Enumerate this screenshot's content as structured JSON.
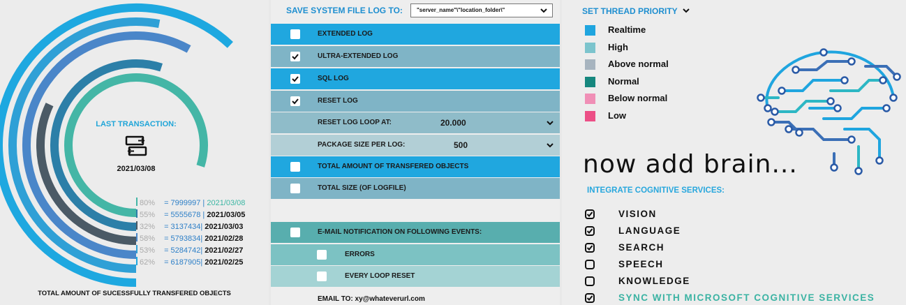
{
  "left": {
    "last_transaction_label": "LAST TRANSACTION:",
    "last_transaction_date": "2021/03/08",
    "transfer_icon": "transfer-arrows-icon",
    "rows": [
      {
        "pct": "80%",
        "value": "= 7999997 |",
        "date": "2021/03/08",
        "percent": 80
      },
      {
        "pct": "55%",
        "value": "= 5555678 |",
        "date": "2021/03/05",
        "percent": 55
      },
      {
        "pct": "32%",
        "value": "= 3137434|",
        "date": "2021/03/03",
        "percent": 32
      },
      {
        "pct": "58%",
        "value": "= 5793834|",
        "date": "2021/02/28",
        "percent": 58
      },
      {
        "pct": "53%",
        "value": "= 5284742|",
        "date": "2021/02/27",
        "percent": 53
      },
      {
        "pct": "62%",
        "value": "= 6187905|",
        "date": "2021/02/25",
        "percent": 62
      }
    ],
    "row_colors": [
      "#44b6a6",
      "#2c7fa8",
      "#4b5a66",
      "#4a86c9",
      "#2fa0d6",
      "#1ea8e0"
    ],
    "footer": "TOTAL AMOUNT OF SUCESSFULLY TRANSFERED OBJECTS"
  },
  "middle": {
    "save_label": "SAVE SYSTEM FILE LOG TO:",
    "save_select_value": "\"server_name\"\\\"location_folder\\\"",
    "options": [
      {
        "label": "EXTENDED LOG",
        "checked": false
      },
      {
        "label": "ULTRA-EXTENDED LOG",
        "checked": true
      },
      {
        "label": "SQL LOG",
        "checked": true
      },
      {
        "label": "RESET LOG",
        "checked": true
      }
    ],
    "reset_loop_label": "RESET LOG LOOP AT:",
    "reset_loop_value": "20.000",
    "package_size_label": "PACKAGE SIZE PER LOG:",
    "package_size_value": "500",
    "total_objects_label": "TOTAL AMOUNT OF TRANSFERED OBJECTS",
    "total_size_label": "TOTAL SIZE (OF LOGFILE)",
    "email_notify_label": "E-MAIL NOTIFICATION ON FOLLOWING EVENTS:",
    "errors_label": "ERRORS",
    "loop_reset_label": "EVERY LOOP RESET",
    "email_to": "EMAIL TO: xy@whateverurl.com"
  },
  "right": {
    "priority_title": "SET THREAD PRIORITY",
    "priorities": [
      {
        "label": "Realtime",
        "color": "#1fa5df"
      },
      {
        "label": "High",
        "color": "#7cc4cd"
      },
      {
        "label": "Above normal",
        "color": "#a7b4bf"
      },
      {
        "label": "Normal",
        "color": "#16877e"
      },
      {
        "label": "Below normal",
        "color": "#f08fb6"
      },
      {
        "label": "Low",
        "color": "#ec4f86"
      }
    ],
    "brain_title": "now add brain...",
    "integrate_label": "INTEGRATE COGNITIVE SERVICES:",
    "services": [
      {
        "label": "VISION",
        "checked": true
      },
      {
        "label": "LANGUAGE",
        "checked": true
      },
      {
        "label": "SEARCH",
        "checked": true
      },
      {
        "label": "SPEECH",
        "checked": false
      },
      {
        "label": "KNOWLEDGE",
        "checked": false
      },
      {
        "label": "SYNC WITH MICROSOFT COGNITIVE SERVICES",
        "checked": true
      }
    ],
    "brain_icon": "circuit-brain-icon"
  }
}
